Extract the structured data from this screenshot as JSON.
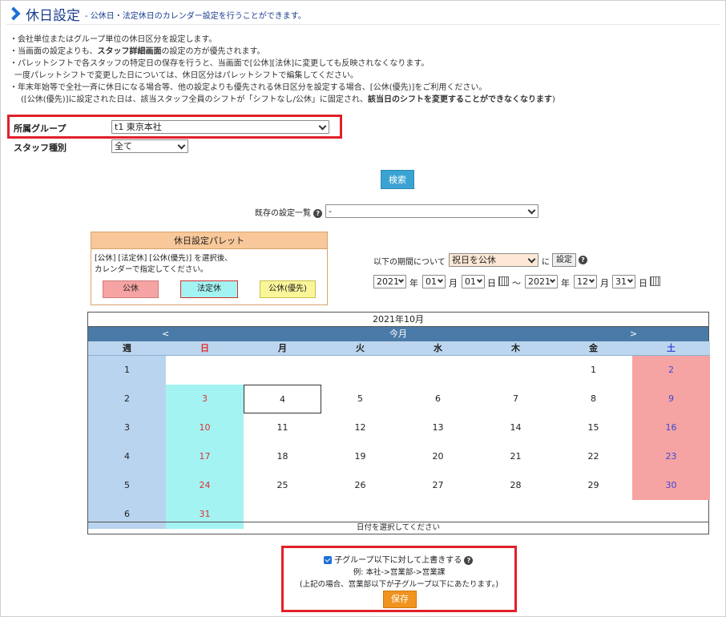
{
  "header": {
    "title": "休日設定",
    "subtitle": "- 公休日・法定休日のカレンダー設定を行うことができます。"
  },
  "notes": {
    "line1": "・会社単位またはグループ単位の休日区分を設定します。",
    "line2_pre": "・当画面の設定よりも、",
    "line2_bold": "スタッフ詳細画面",
    "line2_post": "の設定の方が優先されます。",
    "line3": "・パレットシフトで各スタッフの特定日の保存を行うと、当画面で[公休][法休]に変更しても反映されなくなります。",
    "line4": "一度パレットシフトで変更した日については、休日区分はパレットシフトで編集してください。",
    "line5": "・年末年始等で全社一斉に休日になる場合等、他の設定よりも優先される休日区分を設定する場合、[公休(優先)]をご利用ください。",
    "line6_pre": "([公休(優先)]に設定された日は、該当スタッフ全員のシフトが「シフトなし/公休」に固定され、",
    "line6_bold": "該当日のシフトを変更することができなくなります",
    "line6_post": ")"
  },
  "filters": {
    "group_label": "所属グループ",
    "group_value": "t1 東京本社",
    "staff_type_label": "スタッフ種別",
    "staff_type_value": "全て",
    "search_button": "検索",
    "existing_label": "既存の設定一覧",
    "existing_value": "-"
  },
  "palette": {
    "title": "休日設定パレット",
    "desc1": "[公休] [法定休] [公休(優先)] を選択後、",
    "desc2": "カレンダーで指定してください。",
    "btn_kokyu": "公休",
    "btn_hotei": "法定休",
    "btn_yusen": "公休(優先)"
  },
  "period": {
    "label": "以下の期間について",
    "rule_value": "祝日を公休",
    "ni": "に",
    "set_button": "設定",
    "start_year": "2021",
    "start_month": "01",
    "start_day": "01",
    "end_year": "2021",
    "end_month": "12",
    "end_day": "31",
    "year_unit": "年",
    "month_unit": "月",
    "day_unit": "日",
    "tilde": "～"
  },
  "calendar": {
    "month_title": "2021年10月",
    "prev": "<",
    "today": "今月",
    "next": ">",
    "headers": [
      "週",
      "日",
      "月",
      "火",
      "水",
      "木",
      "金",
      "土"
    ],
    "weeks": [
      [
        "1",
        "",
        "",
        "",
        "",
        "",
        "1",
        "2"
      ],
      [
        "2",
        "3",
        "4",
        "5",
        "6",
        "7",
        "8",
        "9"
      ],
      [
        "3",
        "10",
        "11",
        "12",
        "13",
        "14",
        "15",
        "16"
      ],
      [
        "4",
        "17",
        "18",
        "19",
        "20",
        "21",
        "22",
        "23"
      ],
      [
        "5",
        "24",
        "25",
        "26",
        "27",
        "28",
        "29",
        "30"
      ],
      [
        "6",
        "31",
        "",
        "",
        "",
        "",
        "",
        ""
      ]
    ],
    "footer": "日付を選択してください"
  },
  "bottom": {
    "checkbox_label": "子グループ以下に対して上書きする",
    "example1": "例: 本社->営業部->営業課",
    "example2": "(上記の場合、営業部以下が子グループ以下にあたります。)",
    "save_button": "保存"
  },
  "colors": {
    "accent_blue": "#3aa3d2",
    "save_orange": "#f0931f",
    "highlight_red": "#e0202a",
    "sunday_bg": "#a4f3f3",
    "saturday_bg": "#f6a3a3"
  }
}
